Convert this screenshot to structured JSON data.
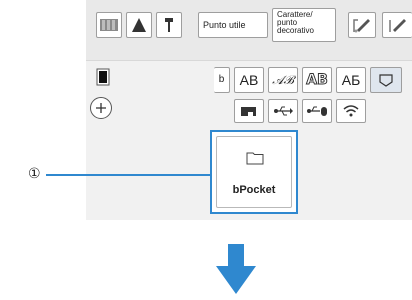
{
  "toolbar": {
    "punto_utile_label": "Punto utile",
    "carattere_label": "Carattere/\npunto\ndecorativo",
    "icons": [
      "book-pages-icon",
      "cone-icon",
      "pin-icon",
      "pattern-edit-icon",
      "pattern-edit-icon-2"
    ]
  },
  "font_tabs": {
    "ab_regular": "AB",
    "ab_italic": "𝒜ℬ",
    "ab_outline": "AB",
    "ab_cyrillic": "АБ"
  },
  "storage_row": {
    "icons": [
      "machine-icon",
      "usb-icon",
      "usb-mouse-icon",
      "wifi-icon"
    ]
  },
  "pocket": {
    "label": "bPocket",
    "icon": "folder-icon"
  },
  "callout": {
    "number": "①"
  },
  "colors": {
    "accent_blue": "#2f88cf",
    "toolbar_bg": "#e9e9e9",
    "panel_bg": "#f1f1f1"
  }
}
